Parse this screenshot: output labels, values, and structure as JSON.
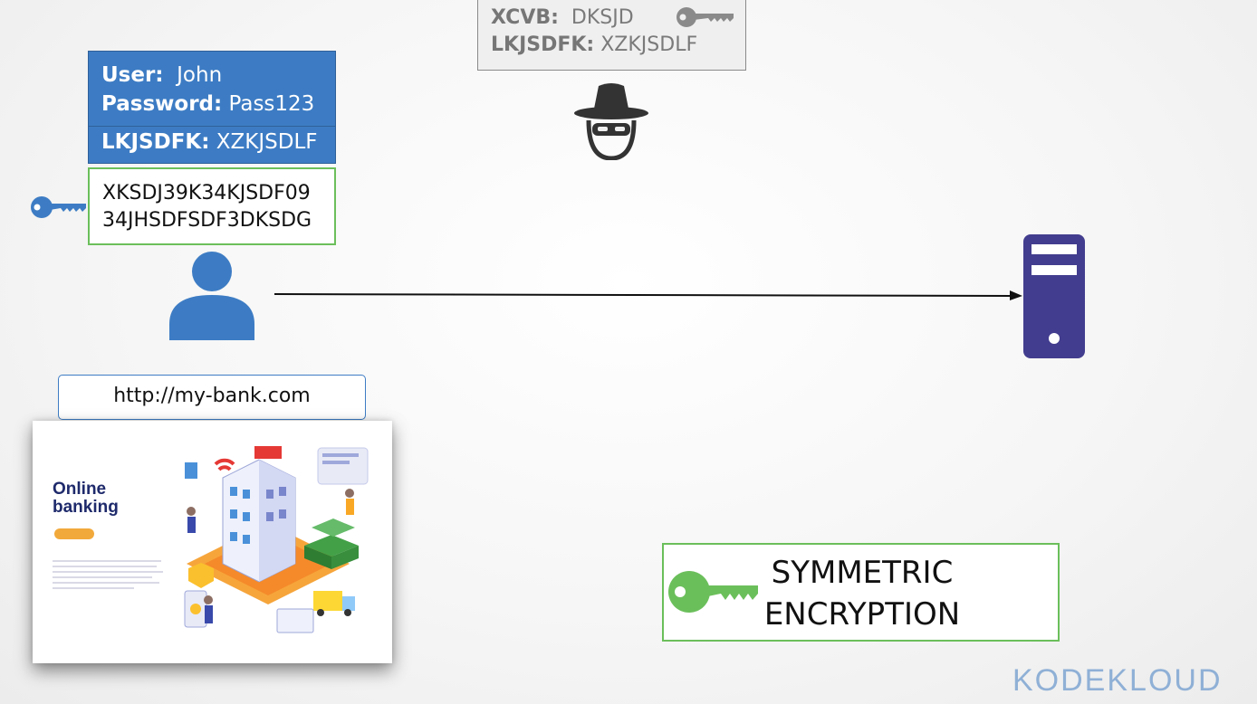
{
  "eavesdropper": {
    "line1_label": "XCVB:",
    "line1_value": "DKSJD",
    "line2_label": "LKJSDFK:",
    "line2_value": "XZKJSDLF"
  },
  "credentials": {
    "user_label": "User:",
    "user_value": "John",
    "password_label": "Password:",
    "password_value": "Pass123",
    "key_label": "LKJSDFK:",
    "key_value": "XZKJSDLF"
  },
  "encrypted": {
    "line1": "XKSDJ39K34KJSDF09",
    "line2": "34JHSDFSDF3DKSDG"
  },
  "browser": {
    "url": "http://my-bank.com",
    "banner_title_line1": "Online",
    "banner_title_line2": "banking"
  },
  "label": {
    "line1": "SYMMETRIC",
    "line2": "ENCRYPTION"
  },
  "brand": {
    "logo_text": "KODEKLOUD"
  },
  "colors": {
    "blue": "#3d7cc4",
    "green": "#6bbf5b",
    "server_purple": "#433d8f",
    "hacker_gray": "#8a8a8a"
  },
  "icons": [
    "key-icon",
    "hacker-icon",
    "user-icon",
    "server-icon"
  ]
}
